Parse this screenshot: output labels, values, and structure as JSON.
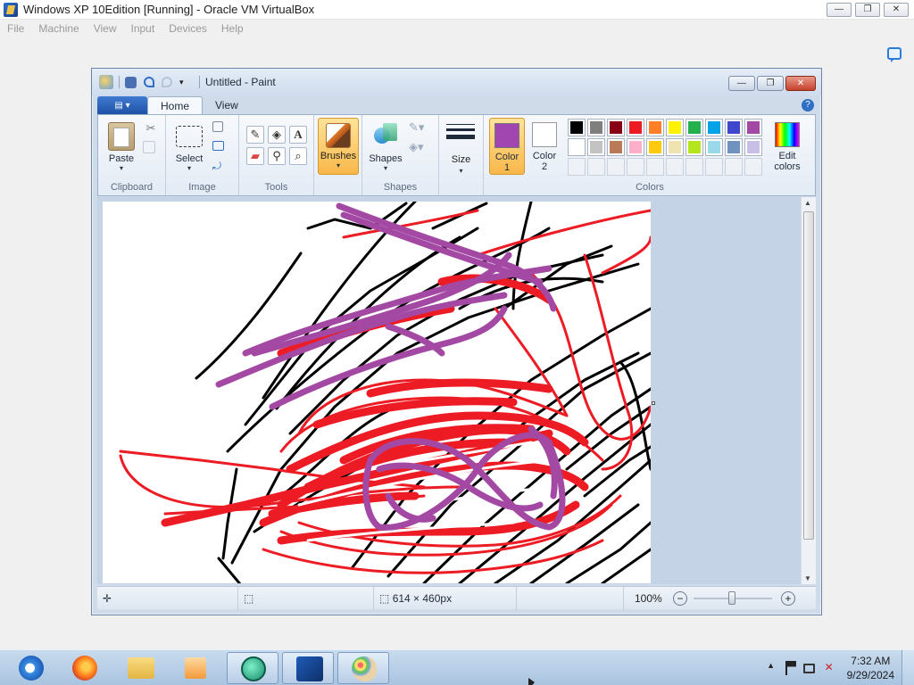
{
  "vbox": {
    "title": "Windows XP 10Edition [Running] - Oracle VM VirtualBox",
    "menu": [
      "File",
      "Machine",
      "View",
      "Input",
      "Devices",
      "Help"
    ],
    "ctrl_min": "—",
    "ctrl_restore": "❐",
    "ctrl_close": "✕"
  },
  "paint": {
    "title": "Untitled - Paint",
    "tabs": {
      "app_menu": "▤ ▾",
      "home": "Home",
      "view": "View"
    },
    "help": "?",
    "groups": {
      "clipboard": {
        "label": "Clipboard",
        "paste": "Paste"
      },
      "image": {
        "label": "Image",
        "select": "Select"
      },
      "tools": {
        "label": "Tools"
      },
      "brushes": {
        "label": "Brushes"
      },
      "shapes": {
        "label": "Shapes",
        "shapes_btn": "Shapes"
      },
      "size": {
        "label": "Size"
      },
      "colors": {
        "label": "Colors",
        "color1_line1": "Color",
        "color1_line2": "1",
        "color2_line1": "Color",
        "color2_line2": "2",
        "edit_line1": "Edit",
        "edit_line2": "colors",
        "color1_value": "#a146b0",
        "color2_value": "#ffffff",
        "palette_row1": [
          "#000000",
          "#7f7f7f",
          "#880015",
          "#ed1c24",
          "#ff7f27",
          "#fff200",
          "#22b14c",
          "#00a2e8",
          "#3f48cc",
          "#a349a4"
        ],
        "palette_row2": [
          "#ffffff",
          "#c3c3c3",
          "#b97a57",
          "#ffaec9",
          "#ffc90e",
          "#efe4b0",
          "#b5e61d",
          "#99d9ea",
          "#7092be",
          "#c8bfe7"
        ]
      }
    },
    "status": {
      "cursor_icon": "✛",
      "selection_icon": "⬚",
      "size_text": "614 × 460px",
      "zoom": "100%",
      "zoom_out": "−",
      "zoom_in": "+"
    }
  },
  "taskbar": {
    "time": "7:32 AM",
    "date": "9/29/2024",
    "tray_arrow": "▲"
  }
}
